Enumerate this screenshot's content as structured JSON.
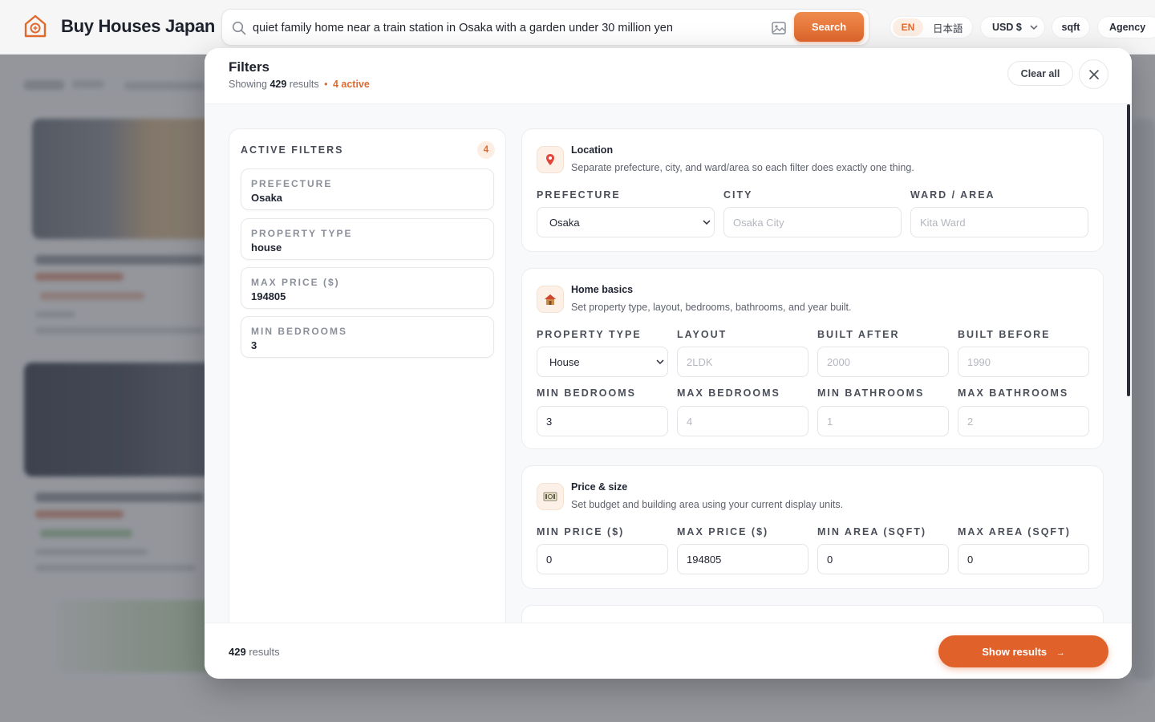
{
  "app": {
    "brand": "Buy Houses Japan",
    "accent_color": "#e06a2e"
  },
  "search": {
    "value": "quiet family home near a train station in Osaka with a garden under 30 million yen",
    "button_label": "Search"
  },
  "header": {
    "lang_en": "EN",
    "lang_ja": "日本語",
    "currency": "USD $",
    "units": "sqft",
    "agency": "Agency"
  },
  "filters_modal": {
    "title": "Filters",
    "showing_prefix": "Showing",
    "result_count": "429",
    "results_word": "results",
    "separator": "•",
    "active_text": "4 active",
    "clear_all_label": "Clear all",
    "active_filters": {
      "title": "ACTIVE FILTERS",
      "count": "4",
      "items": [
        {
          "key": "PREFECTURE",
          "value": "Osaka"
        },
        {
          "key": "PROPERTY TYPE",
          "value": "house"
        },
        {
          "key": "MAX PRICE ($)",
          "value": "194805"
        },
        {
          "key": "MIN BEDROOMS",
          "value": "3"
        }
      ]
    },
    "location": {
      "icon": "map-pin-icon",
      "title": "Location",
      "description": "Separate prefecture, city, and ward/area so each filter does exactly one thing.",
      "prefecture_label": "PREFECTURE",
      "prefecture_value": "Osaka",
      "city_label": "CITY",
      "city_placeholder": "Osaka City",
      "ward_label": "WARD / AREA",
      "ward_placeholder": "Kita Ward"
    },
    "home_basics": {
      "icon": "house-icon",
      "title": "Home basics",
      "description": "Set property type, layout, bedrooms, bathrooms, and year built.",
      "property_type_label": "PROPERTY TYPE",
      "property_type_value": "House",
      "layout_label": "LAYOUT",
      "layout_placeholder": "2LDK",
      "built_after_label": "BUILT AFTER",
      "built_after_placeholder": "2000",
      "built_before_label": "BUILT BEFORE",
      "built_before_placeholder": "1990",
      "min_bedrooms_label": "MIN BEDROOMS",
      "min_bedrooms_value": "3",
      "max_bedrooms_label": "MAX BEDROOMS",
      "max_bedrooms_placeholder": "4",
      "min_bathrooms_label": "MIN BATHROOMS",
      "min_bathrooms_placeholder": "1",
      "max_bathrooms_label": "MAX BATHROOMS",
      "max_bathrooms_placeholder": "2"
    },
    "price_size": {
      "icon": "yen-notes-icon",
      "title": "Price & size",
      "description": "Set budget and building area using your current display units.",
      "min_price_label": "MIN PRICE ($)",
      "min_price_value": "0",
      "max_price_label": "MAX PRICE ($)",
      "max_price_value": "194805",
      "min_area_label": "MIN AREA (SQFT)",
      "min_area_value": "0",
      "max_area_label": "MAX AREA (SQFT)",
      "max_area_value": "0"
    },
    "footer": {
      "count": "429",
      "results_word": "results",
      "show_results_label": "Show results",
      "arrow": "→"
    }
  }
}
